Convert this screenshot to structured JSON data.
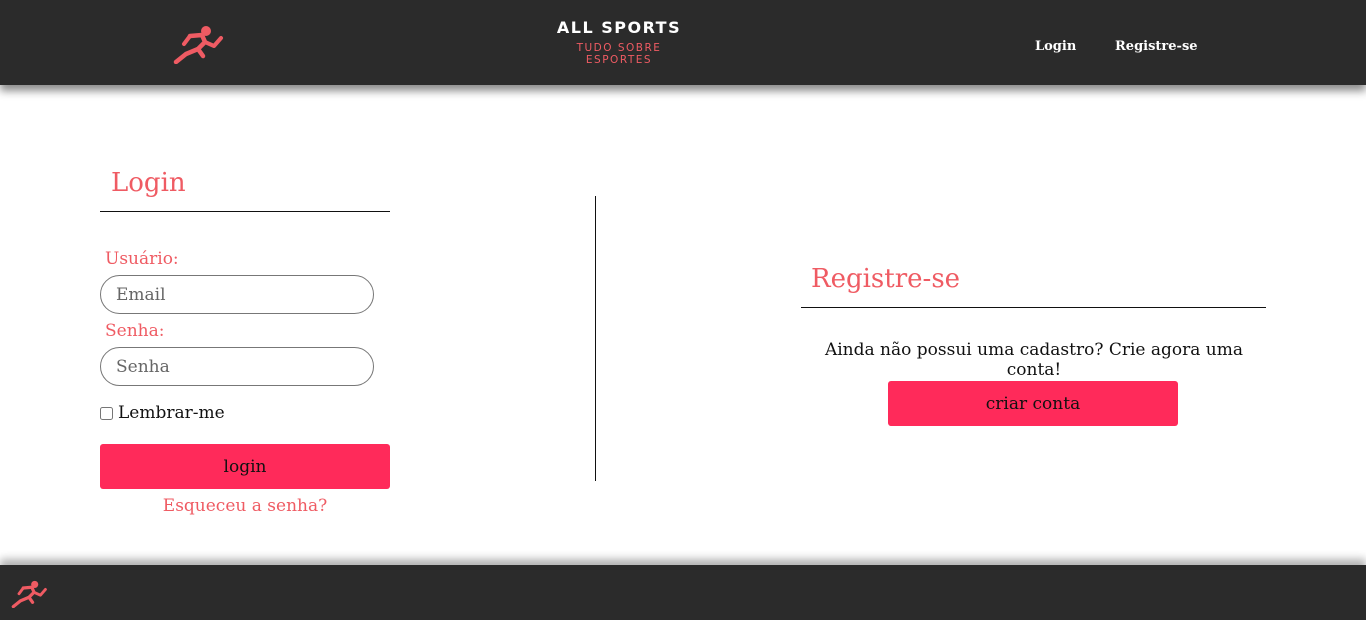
{
  "header": {
    "logo_icon": "running-person-icon",
    "brand_title": "ALL SPORTS",
    "brand_subtitle_1": "TUDO SOBRE",
    "brand_subtitle_2": "ESPORTES",
    "nav": {
      "login": "Login",
      "register": "Registre-se"
    }
  },
  "login": {
    "title": "Login",
    "user_label": "Usuário:",
    "user_placeholder": "Email",
    "password_label": "Senha:",
    "password_placeholder": "Senha",
    "remember_label": "Lembrar-me",
    "button": "login",
    "forgot": "Esqueceu a senha?"
  },
  "register": {
    "title": "Registre-se",
    "text": "Ainda não possui uma cadastro? Crie agora uma conta!",
    "button": "criar conta"
  },
  "footer": {
    "logo_icon": "running-person-icon"
  },
  "colors": {
    "accent": "#ef5b63",
    "button": "#ff2a5a",
    "bar": "#2b2b2b"
  }
}
